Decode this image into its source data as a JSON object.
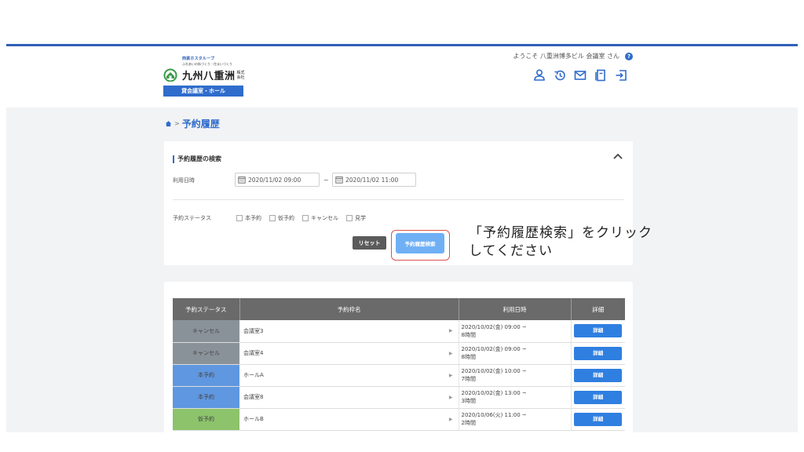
{
  "logo": {
    "group": "西鉄ホスタルーブ",
    "tagline": "ふれあいの街づくり・住まいづくり",
    "name": "九州八重洲",
    "corp": "株式会社",
    "service": "貸会議室・ホール"
  },
  "header": {
    "welcome": "ようこそ 八重洲博多ビル 会議室 さん",
    "help": "?",
    "icons": [
      "user-icon",
      "history-icon",
      "mail-icon",
      "document-icon",
      "logout-icon"
    ]
  },
  "breadcrumb": {
    "separator": ">",
    "title": "予約履歴"
  },
  "search": {
    "title": "予約履歴の検索",
    "date_label": "利用日時",
    "date_from": "2020/11/02 09:00",
    "date_sep": "~",
    "date_to": "2020/11/02 11:00",
    "status_label": "予約ステータス",
    "statuses": [
      "本予約",
      "仮予約",
      "キャンセル",
      "見学"
    ],
    "reset_label": "リセット",
    "search_label": "予約履歴検索"
  },
  "table": {
    "headers": [
      "予約ステータス",
      "予約枠名",
      "利用日時",
      "詳細"
    ],
    "rows": [
      {
        "status": "キャンセル",
        "color": "#8a9299",
        "name": "会議室3",
        "datetime": "2020/10/02(金) 09:00 ~",
        "duration": "8時間",
        "detail": "詳細"
      },
      {
        "status": "キャンセル",
        "color": "#8a9299",
        "name": "会議室4",
        "datetime": "2020/10/02(金) 09:00 ~",
        "duration": "8時間",
        "detail": "詳細"
      },
      {
        "status": "本予約",
        "color": "#5f97e0",
        "name": "ホールA",
        "datetime": "2020/10/02(金) 10:00 ~",
        "duration": "7時間",
        "detail": "詳細"
      },
      {
        "status": "本予約",
        "color": "#5f97e0",
        "name": "会議室8",
        "datetime": "2020/10/02(金) 13:00 ~",
        "duration": "3時間",
        "detail": "詳細"
      },
      {
        "status": "仮予約",
        "color": "#8cc36b",
        "name": "ホールB",
        "datetime": "2020/10/06(火) 11:00 ~",
        "duration": "2時間",
        "detail": "詳細"
      }
    ]
  },
  "annotation": {
    "line1": "「予約履歴検索」をクリック",
    "line2": "してください"
  },
  "colors": {
    "accent": "#2f6ccc",
    "highlight": "#d9534f",
    "topline": "#2f5fb8"
  }
}
